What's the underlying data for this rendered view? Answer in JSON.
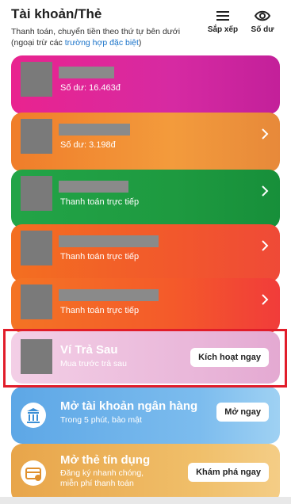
{
  "header": {
    "title": "Tài khoản/Thẻ",
    "subtitle_main": "Thanh toán, chuyển tiền theo thứ tự bên dưới (ngoại trừ các ",
    "subtitle_link": "trường hợp đặc biệt",
    "subtitle_end": ")",
    "sort_label": "Sắp xếp",
    "balance_label": "Số dư"
  },
  "accounts": [
    {
      "name": "",
      "detail": "Số dư: 16.463đ",
      "color": "#e9238f"
    },
    {
      "name": "",
      "detail": "Số dư: 3.198đ",
      "color": "#f07d2a"
    },
    {
      "name": "",
      "detail": "Thanh toán trực tiếp",
      "color": "#22a447"
    },
    {
      "name": "",
      "detail": "Thanh toán trực tiếp",
      "color": "#f36f20"
    },
    {
      "name": "",
      "detail": "Thanh toán trực tiếp",
      "color": "#f45a2a"
    }
  ],
  "promos": [
    {
      "title": "Ví Trả Sau",
      "subtitle": "Mua trước trả sau",
      "button": "Kích hoạt ngay"
    },
    {
      "title": "Mở tài khoản ngân hàng",
      "subtitle": "Trong 5 phút, bảo mật",
      "button": "Mở ngay"
    },
    {
      "title": "Mở thẻ tín dụng",
      "subtitle_line1": "Đăng ký nhanh chóng,",
      "subtitle_line2": "miễn phí thanh toán",
      "button": "Khám phá ngay"
    }
  ],
  "colors": {
    "highlight": "#e11d2a",
    "link": "#1a73c9"
  },
  "icons": [
    "menu-icon",
    "eye-icon",
    "chevron-right-icon",
    "bank-icon",
    "credit-card-icon"
  ]
}
